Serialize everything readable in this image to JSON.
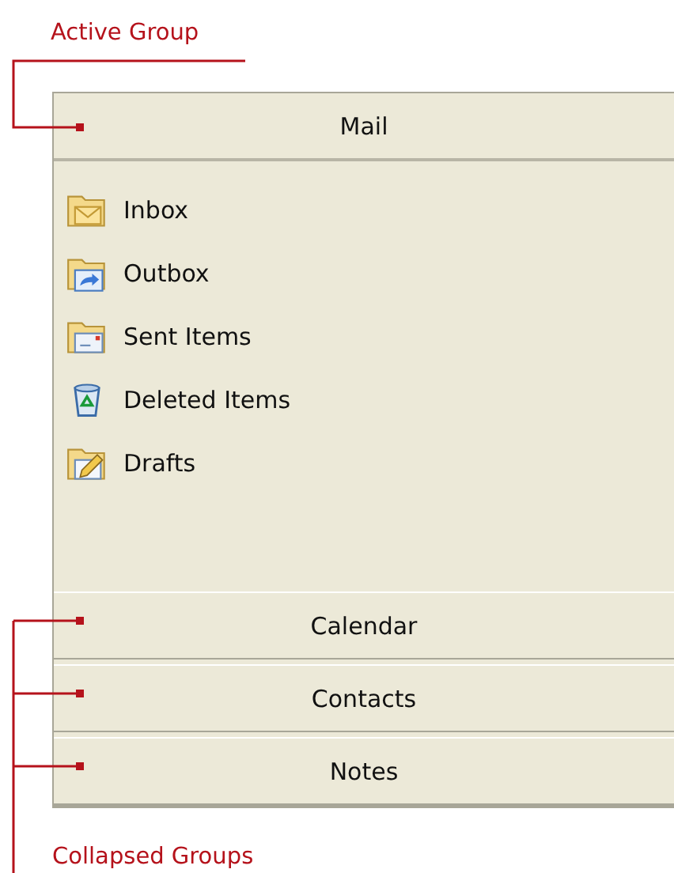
{
  "annotations": [
    {
      "label": "Active Group",
      "kind": "active"
    },
    {
      "label": "Collapsed Groups",
      "kind": "collapsed"
    }
  ],
  "groups": [
    {
      "label": "Mail",
      "expanded": true,
      "items": [
        {
          "label": "Inbox",
          "kind": "inbox"
        },
        {
          "label": "Outbox",
          "kind": "outbox"
        },
        {
          "label": "Sent Items",
          "kind": "sent"
        },
        {
          "label": "Deleted Items",
          "kind": "deleted"
        },
        {
          "label": "Drafts",
          "kind": "drafts"
        }
      ]
    },
    {
      "label": "Calendar",
      "expanded": false
    },
    {
      "label": "Contacts",
      "expanded": false
    },
    {
      "label": "Notes",
      "expanded": false
    }
  ]
}
